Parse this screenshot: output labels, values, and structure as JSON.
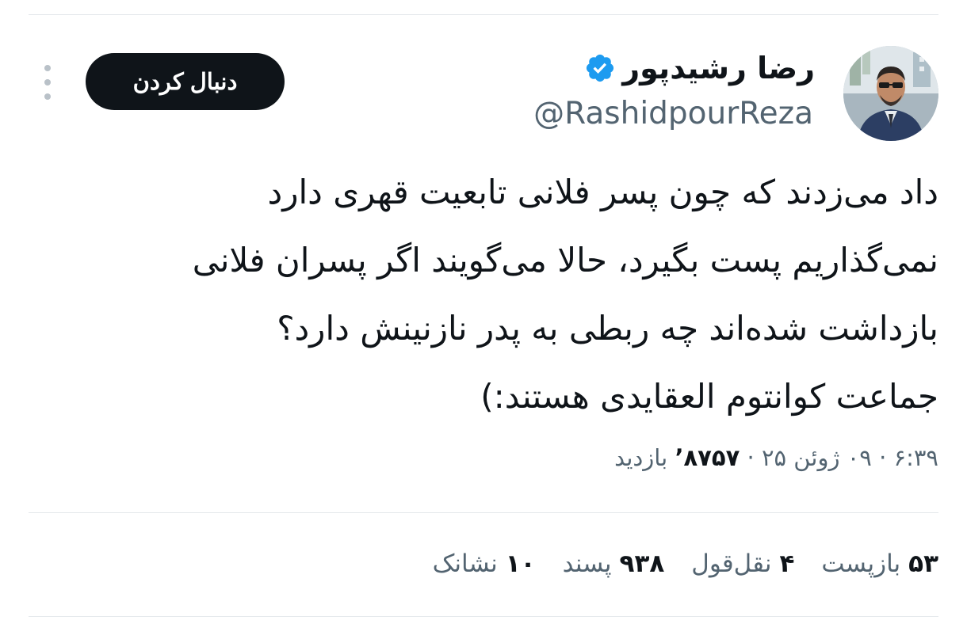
{
  "author": {
    "display_name": "رضا رشیدپور",
    "handle": "@RashidpourReza",
    "verified": true
  },
  "follow_button_label": "دنبال کردن",
  "tweet": {
    "text": "داد می‌زدند که چون پسر فلانی تابعیت قهری دارد\nنمی‌گذاریم پست بگیرد، حالا می‌گویند اگر پسران فلانی\nبازداشت شده‌اند چه ربطی به پدر نازنینش دارد؟\nجماعت کوانتوم العقایدی هستند:)"
  },
  "meta": {
    "time": "۶:۳۹",
    "separator": "·",
    "date": "۰۹ ژوئن ۲۵",
    "views_count": "۸۷۵۷’",
    "views_label": "بازدید"
  },
  "stats": [
    {
      "count": "۵۳",
      "label": "بازپست"
    },
    {
      "count": "۴",
      "label": "نقل‌قول"
    },
    {
      "count": "۹۳۸",
      "label": "پسند"
    },
    {
      "count": "۱۰",
      "label": "نشانک"
    }
  ],
  "colors": {
    "text_primary": "#0f1419",
    "text_secondary": "#536471",
    "verified_blue": "#1d9bf0",
    "button_bg": "#0f1419",
    "divider": "#e4e8eb"
  },
  "icons": {
    "verified": "verified-badge-icon",
    "more": "more-vertical-icon",
    "avatar": "profile-photo"
  }
}
